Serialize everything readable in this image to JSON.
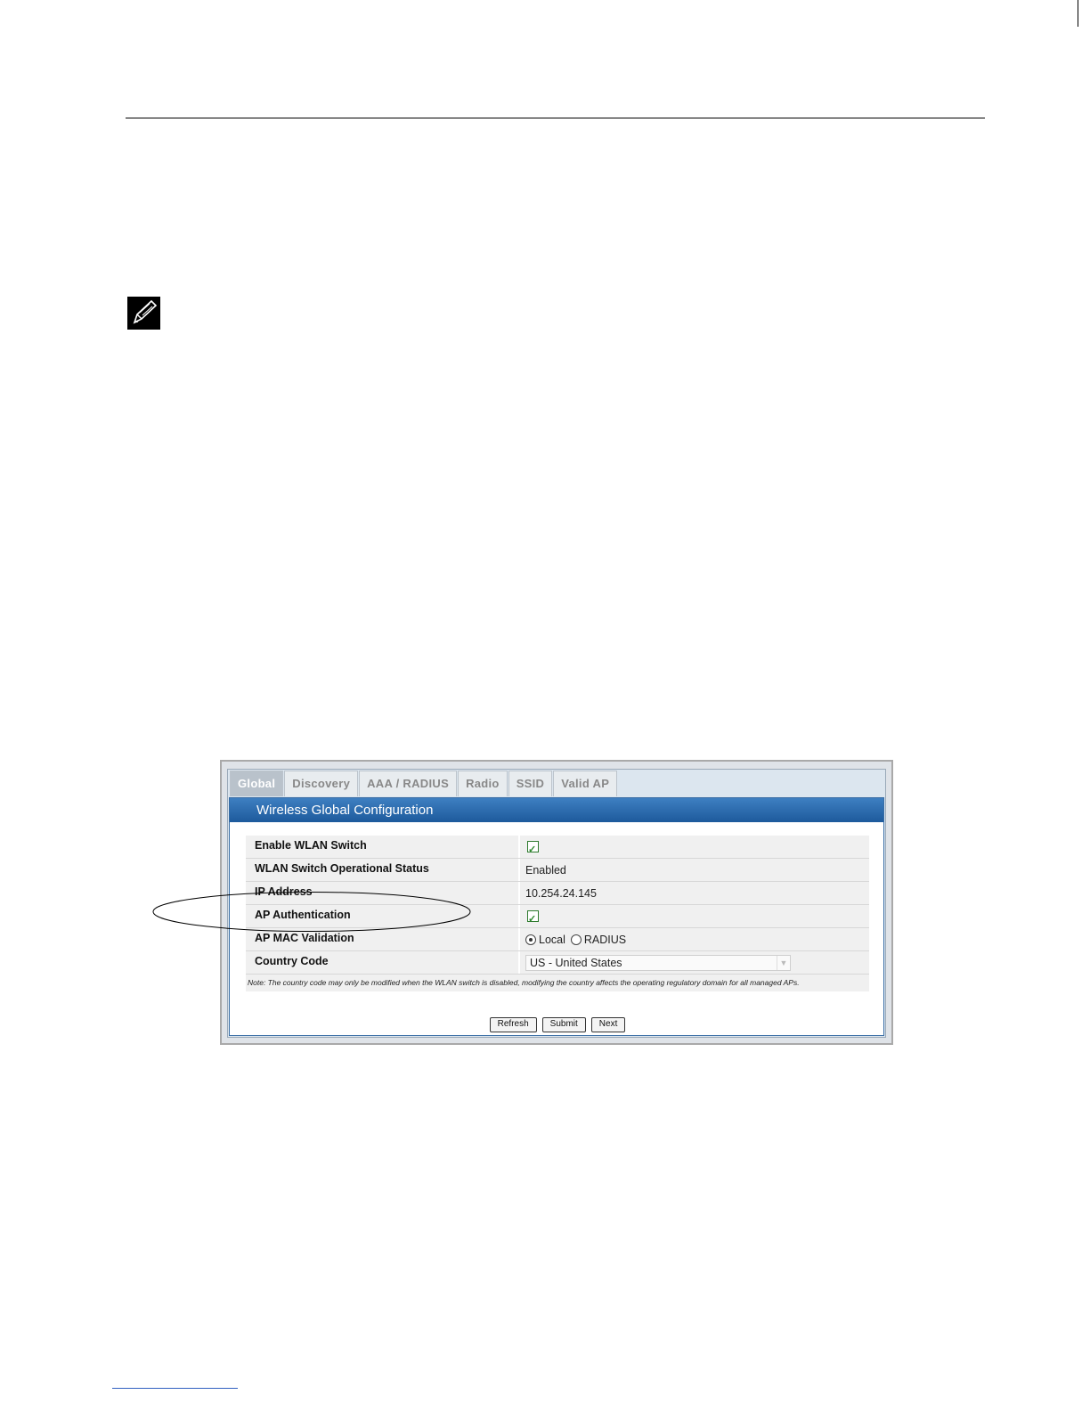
{
  "tabs": [
    "Global",
    "Discovery",
    "AAA / RADIUS",
    "Radio",
    "SSID",
    "Valid AP"
  ],
  "panel_title": "Wireless Global Configuration",
  "rows": {
    "enable_wlan": {
      "label": "Enable WLAN Switch"
    },
    "op_status": {
      "label": "WLAN Switch Operational Status",
      "value": "Enabled"
    },
    "ip_address": {
      "label": "IP Address",
      "value": "10.254.24.145"
    },
    "ap_auth": {
      "label": "AP Authentication"
    },
    "ap_mac": {
      "label": "AP MAC Validation",
      "option_local": "Local",
      "option_radius": "RADIUS"
    },
    "country": {
      "label": "Country Code",
      "value": "US - United States"
    }
  },
  "note": "Note: The country code may only be modified when the WLAN switch is disabled, modifying the country affects the operating regulatory domain for all managed APs.",
  "buttons": {
    "refresh": "Refresh",
    "submit": "Submit",
    "next": "Next"
  }
}
